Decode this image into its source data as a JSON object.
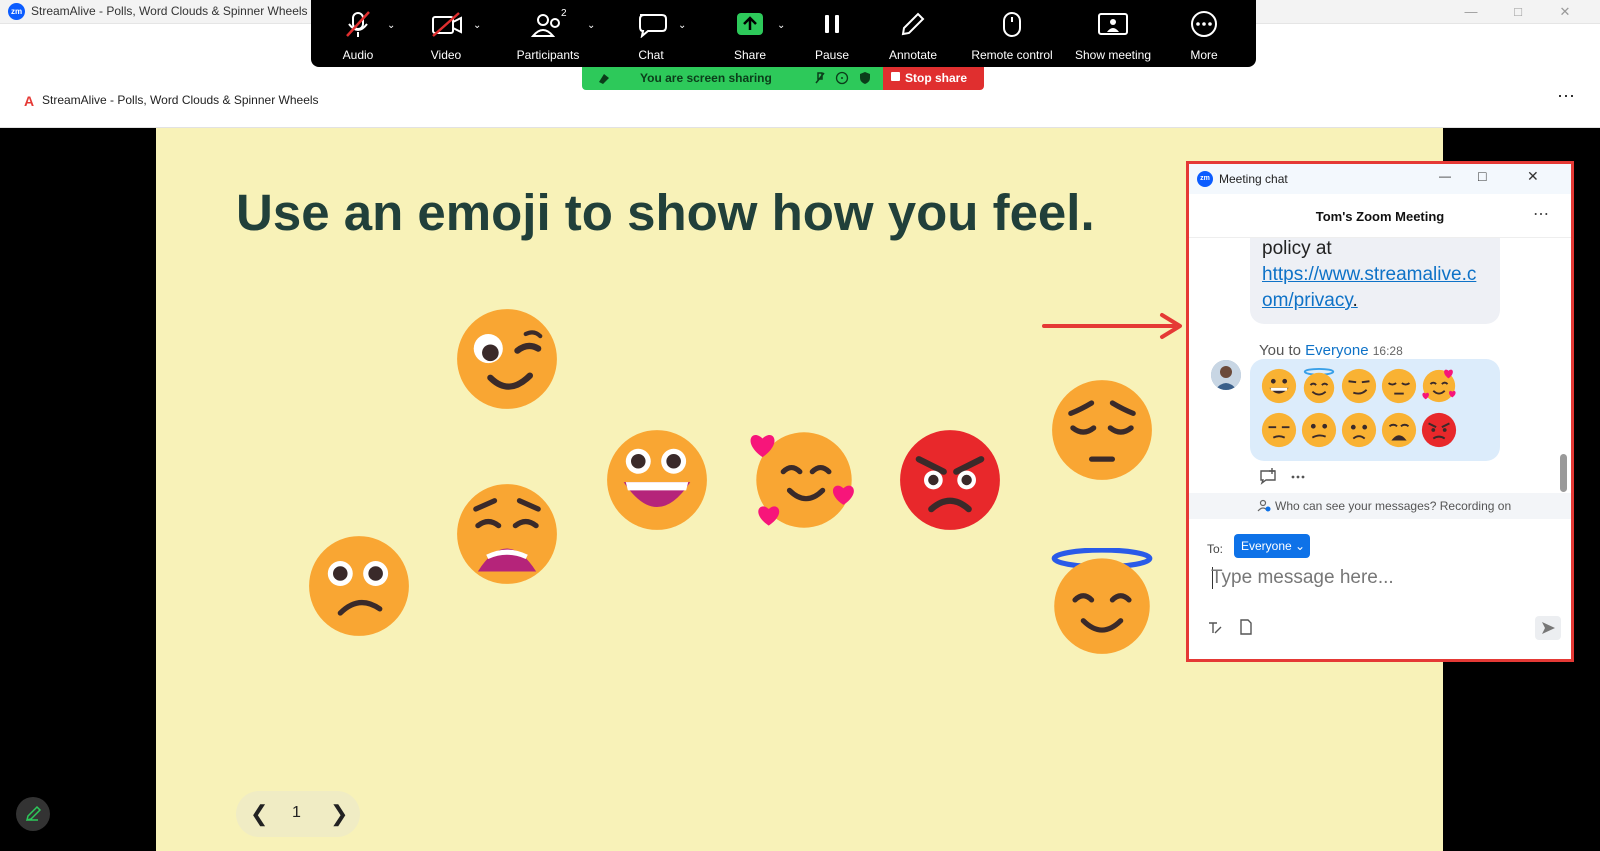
{
  "os_window": {
    "title": "StreamAlive - Polls, Word Clouds & Spinner Wheels",
    "zoom_logo": "zm"
  },
  "browser_tab": {
    "logo_letter": "A",
    "title": "StreamAlive - Polls, Word Clouds & Spinner Wheels"
  },
  "toolbar": {
    "items": [
      {
        "label": "Audio"
      },
      {
        "label": "Video"
      },
      {
        "label": "Participants",
        "count": "2"
      },
      {
        "label": "Chat"
      },
      {
        "label": "Share"
      },
      {
        "label": "Pause"
      },
      {
        "label": "Annotate"
      },
      {
        "label": "Remote control"
      },
      {
        "label": "Show meeting"
      },
      {
        "label": "More"
      }
    ]
  },
  "sharing_banner": {
    "text": "You are screen sharing",
    "stop_label": "Stop share"
  },
  "slide": {
    "title": "Use an emoji to show how you feel.",
    "page_number": "1",
    "emojis": [
      "wink",
      "grin",
      "smiling-with-hearts",
      "angry",
      "pensive",
      "weary",
      "confused",
      "halo"
    ]
  },
  "chat": {
    "window_title": "Meeting chat",
    "meeting_title": "Tom's Zoom Meeting",
    "message1_line1": "policy at",
    "message1_link_part1": "https://www.streamalive.c",
    "message1_link_part2": "om/privacy",
    "message1_suffix": ".",
    "sender_prefix": "You to",
    "sender_recipient": "Everyone",
    "sender_time": "16:28",
    "visibility_notice": "Who can see your messages? Recording on",
    "to_label": "To:",
    "to_value": "Everyone",
    "input_placeholder": "Type message here..."
  },
  "colors": {
    "slide_bg": "#f8f2b8",
    "title_text": "#21403a",
    "highlight_border": "#e53935",
    "accent_blue": "#0e72e8",
    "banner_green": "#2dc95a",
    "stop_red": "#e02f2f"
  }
}
